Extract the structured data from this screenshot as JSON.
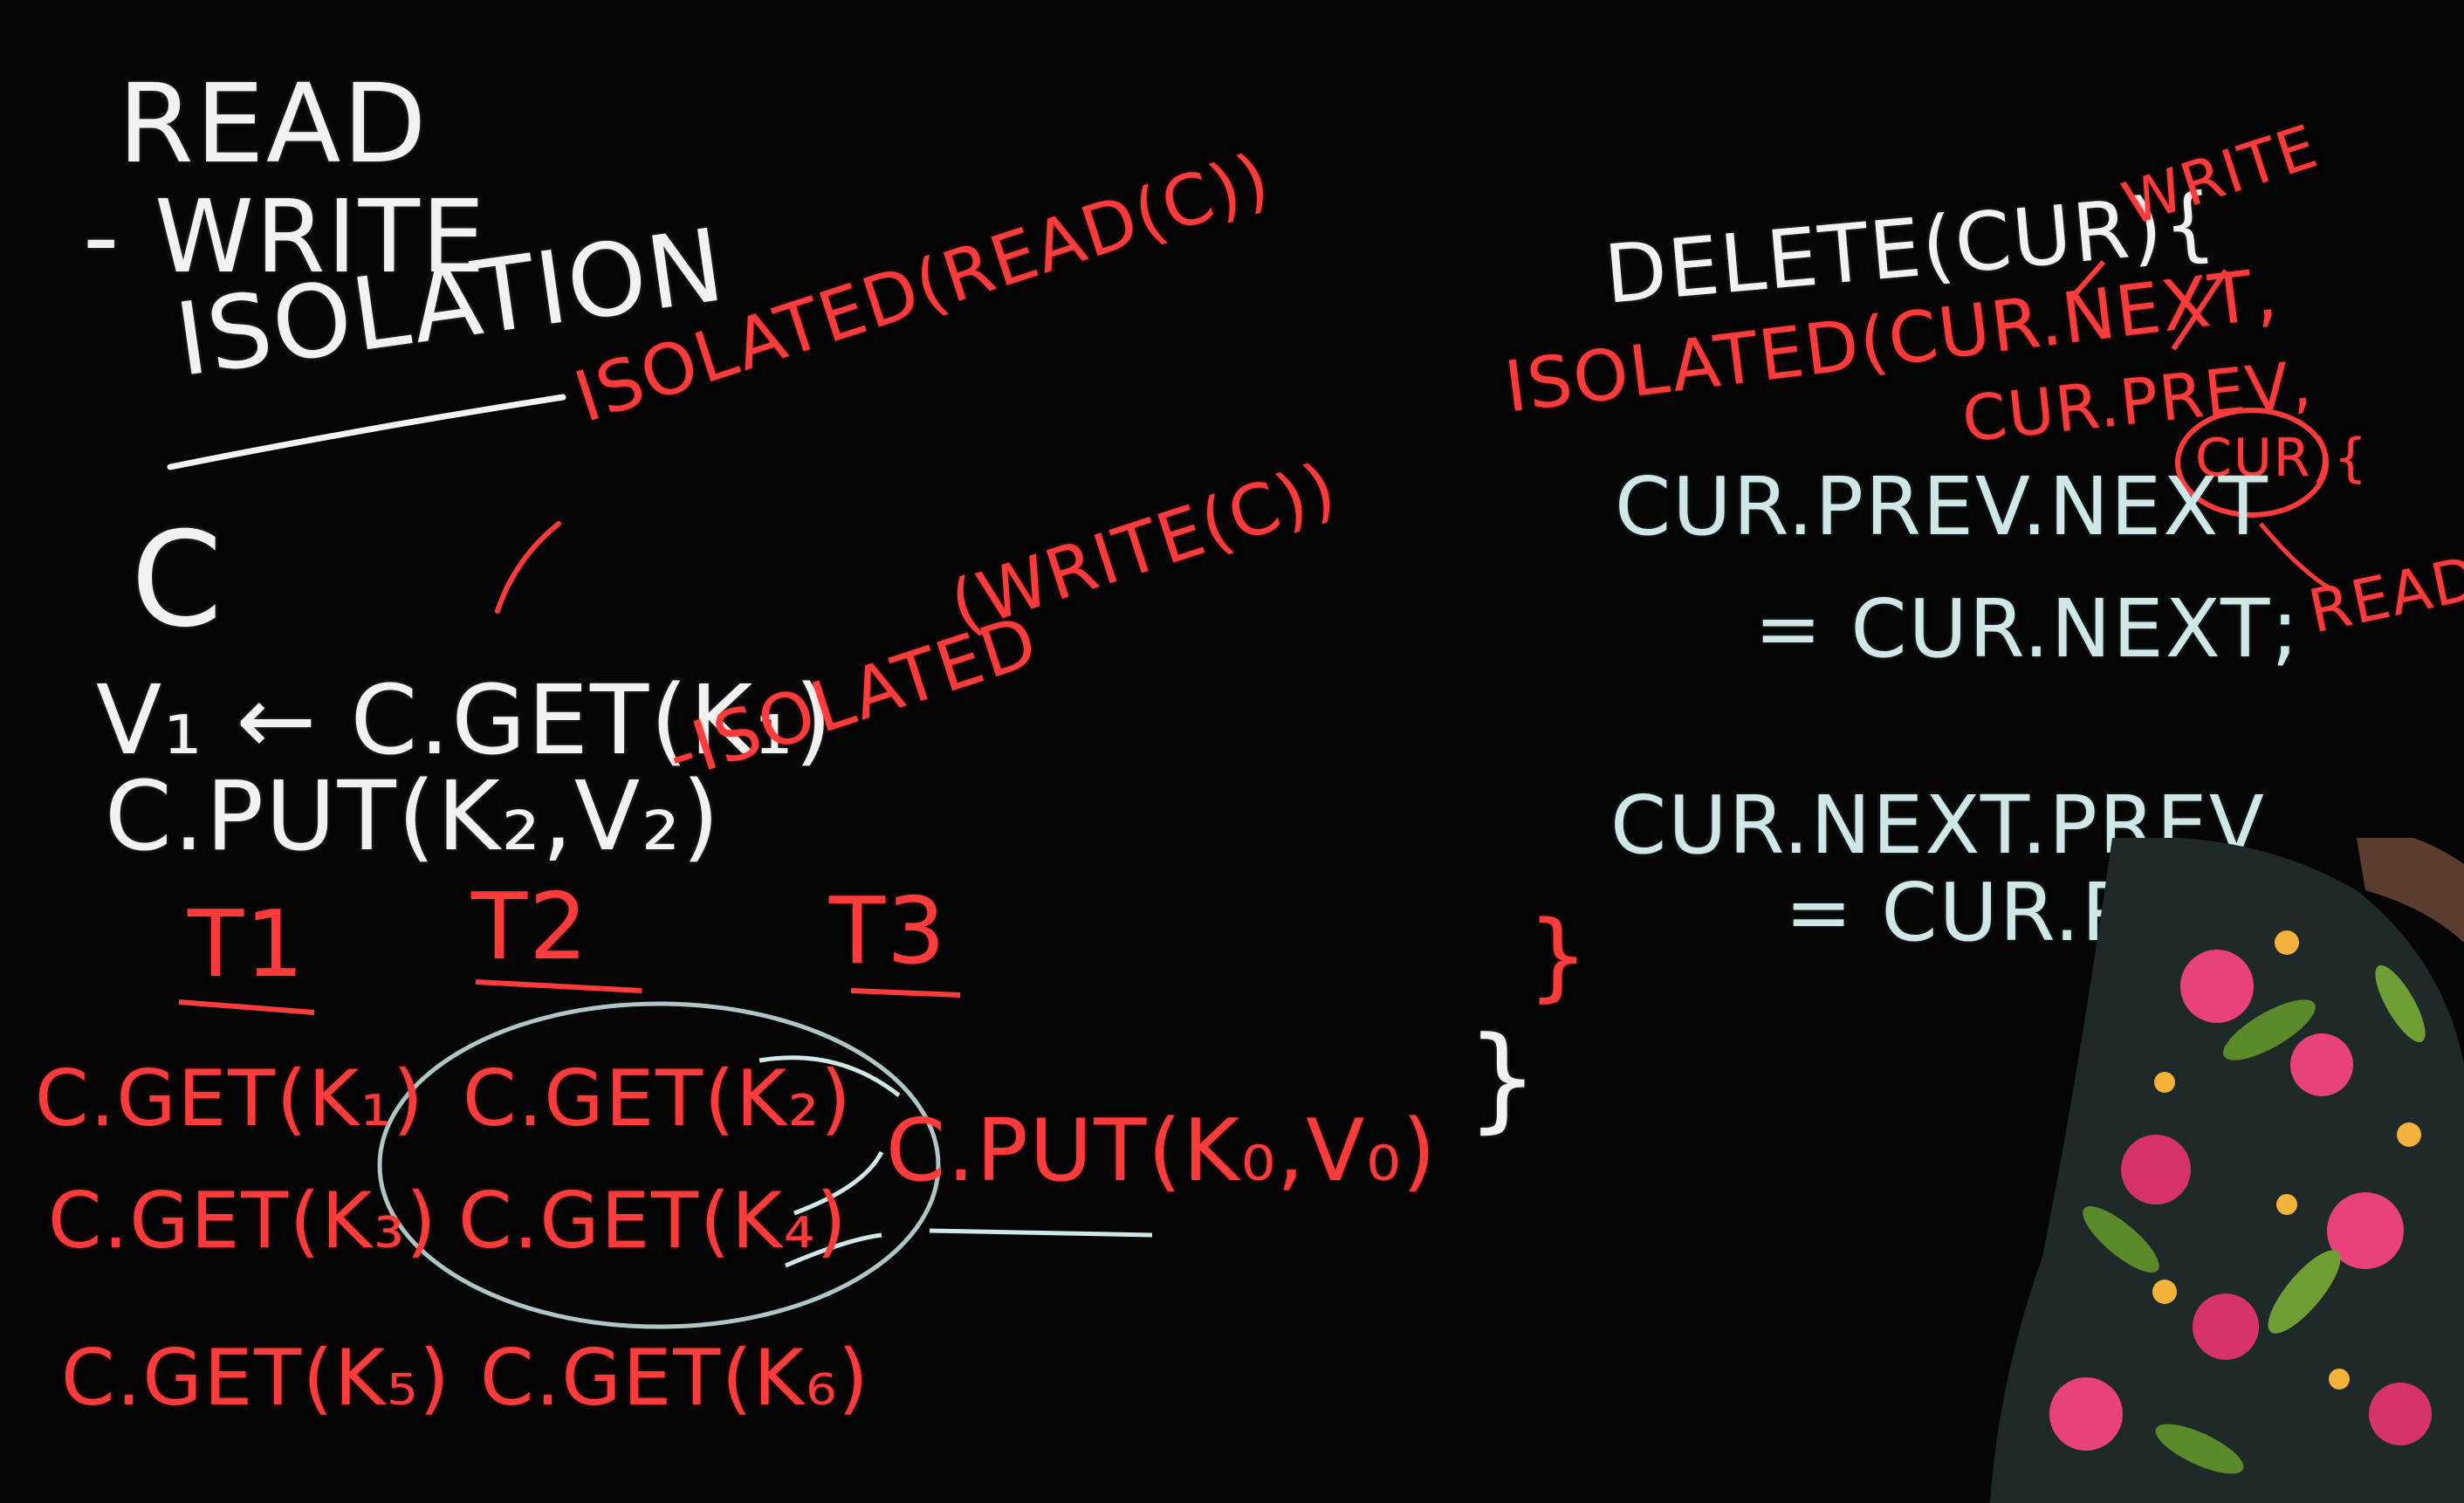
{
  "board": {
    "title": {
      "line1": "READ",
      "line2": "- WRITE",
      "line3": "ISOLATION"
    },
    "left": {
      "c": "C",
      "get_line": "V₁ ← C.GET(K₁)",
      "put_line": "C.PUT(K₂,V₂)",
      "isolated_read": "ISOLATED(READ(C))",
      "isolated_write": "-ISOLATED",
      "write_c": "(WRITE(C))"
    },
    "tasks": {
      "headers": [
        "T1",
        "T2",
        "T3"
      ],
      "t1": [
        "C.GET(K₁)",
        "C.GET(K₃)",
        "C.GET(K₅)"
      ],
      "t2": [
        "C.GET(K₂)",
        "C.GET(K₄)",
        "C.GET(K₆)"
      ],
      "t3": [
        "C.PUT(K₀,V₀)"
      ]
    },
    "right": {
      "delete": "DELETE(CUR){",
      "isolated": "ISOLATED(CUR.NEXT,",
      "cur_prev": "CUR.PREV,",
      "cur": "CUR){",
      "write_note": "WRITE",
      "read_note": "READ",
      "line1": "CUR.PREV.NEXT",
      "line2": "= CUR.NEXT;",
      "line3": "CUR.NEXT.PREV",
      "line4": "= CUR.PREV",
      "close_inner": "}",
      "close_outer": "}"
    }
  },
  "colors": {
    "board": "#050505",
    "white_chalk": "#f2f2f2",
    "red_chalk": "#ff3b3b",
    "teal_chalk": "#cfe7e7",
    "shirt": "#1e2a2a"
  }
}
